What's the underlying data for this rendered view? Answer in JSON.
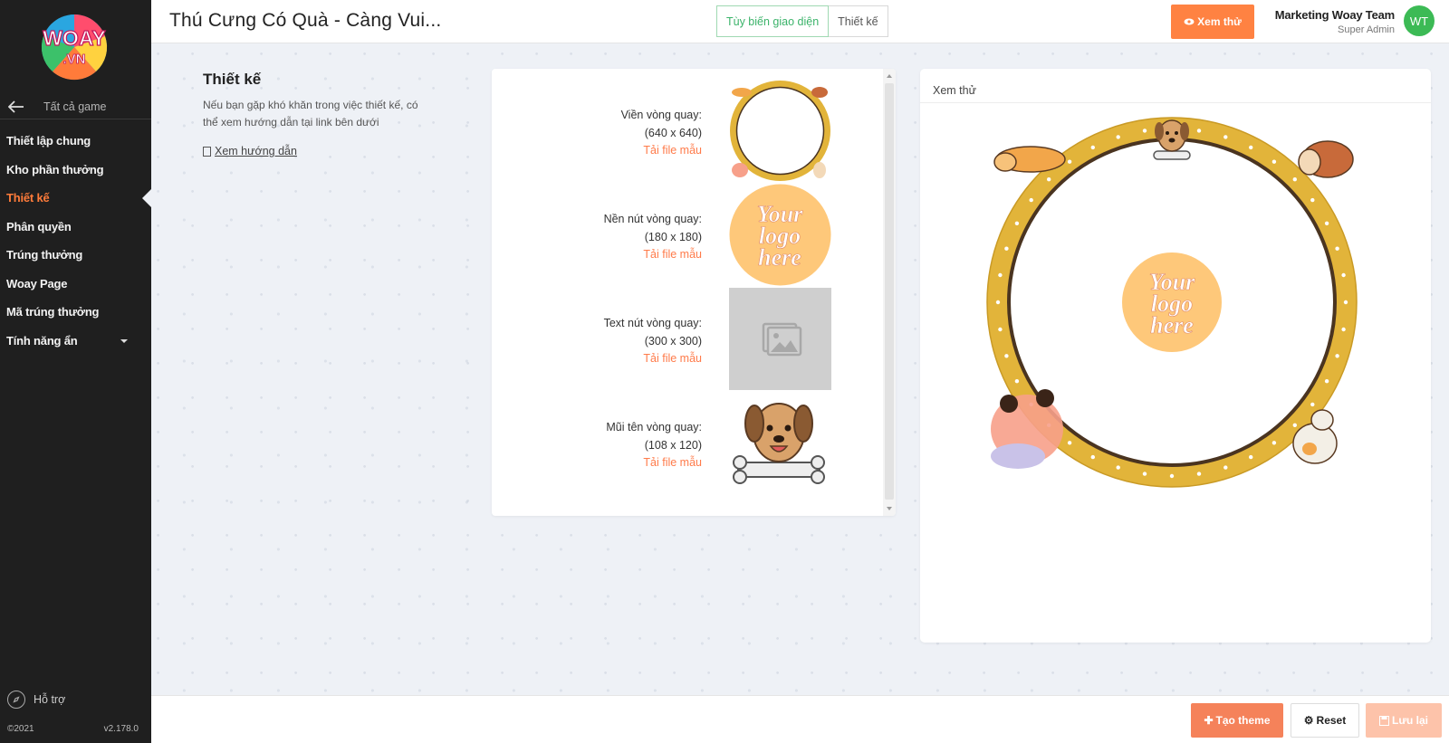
{
  "sidebar": {
    "logo_text": "WOAY",
    "logo_domain": ".VN",
    "back_label": "Tất cả game",
    "items": [
      {
        "label": "Thiết lập chung"
      },
      {
        "label": "Kho phần thưởng"
      },
      {
        "label": "Thiết kế"
      },
      {
        "label": "Phân quyền"
      },
      {
        "label": "Trúng thưởng"
      },
      {
        "label": "Woay Page"
      },
      {
        "label": "Mã trúng thưởng"
      },
      {
        "label": "Tính năng ẩn"
      }
    ],
    "support_label": "Hỗ trợ",
    "copyright": "©2021",
    "version": "v2.178.0"
  },
  "header": {
    "title": "Thú Cưng Có Quà - Càng Vui...",
    "tabs": [
      {
        "label": "Tùy biến giao diện"
      },
      {
        "label": "Thiết kế"
      }
    ],
    "preview_button": "Xem thử",
    "user_name": "Marketing Woay Team",
    "user_role": "Super Admin",
    "avatar_initials": "WT"
  },
  "design": {
    "title": "Thiết kế",
    "description": "Nếu bạn gặp khó khăn trong việc thiết kế, có thể xem hướng dẫn tại link bên dưới",
    "guide_link": "Xem hướng dẫn"
  },
  "assets": [
    {
      "name": "Viền vòng quay:",
      "size": "(640 x 640)",
      "link": "Tải file mẫu"
    },
    {
      "name": "Nền nút vòng quay:",
      "size": "(180 x 180)",
      "link": "Tải file mẫu"
    },
    {
      "name": "Text nút vòng quay:",
      "size": "(300 x 300)",
      "link": "Tải file mẫu"
    },
    {
      "name": "Mũi tên vòng quay:",
      "size": "(108 x 120)",
      "link": "Tải file mẫu"
    }
  ],
  "logo_placeholder": {
    "line1": "Your",
    "line2": "logo",
    "line3": "here"
  },
  "preview": {
    "label": "Xem thử"
  },
  "footer": {
    "create_theme": "Tạo theme",
    "reset": "Reset",
    "save": "Lưu lại"
  },
  "colors": {
    "accent": "#ff8242",
    "active_tab": "#3bb36a",
    "sidebar_bg": "#1f1f1f",
    "wheel_ring": "#e2b43a",
    "logo_bg": "#fec87a",
    "avatar_bg": "#3cba55"
  },
  "icons": [
    "arrow-left-icon",
    "eye-icon",
    "document-icon",
    "compass-icon",
    "plus-icon",
    "gear-icon",
    "save-icon",
    "image-placeholder-icon"
  ]
}
